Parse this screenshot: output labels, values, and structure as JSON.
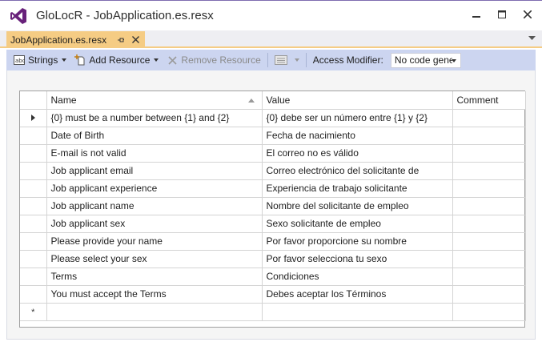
{
  "window": {
    "title": "GloLocR - JobApplication.es.resx",
    "minimize_icon": "minimize-icon",
    "maximize_icon": "maximize-icon",
    "close_icon": "close-icon"
  },
  "tab": {
    "label": "JobApplication.es.resx",
    "pin_icon": "pin-icon",
    "close_icon": "close-icon",
    "accent_color": "#f5cc84"
  },
  "toolbar": {
    "strings_label": "Strings",
    "add_resource_label": "Add Resource",
    "remove_resource_label": "Remove Resource",
    "access_modifier_label": "Access Modifier:",
    "access_modifier_value": "No code generation"
  },
  "grid": {
    "columns": [
      "Name",
      "Value",
      "Comment"
    ],
    "rows": [
      {
        "name": "{0} must be a number between {1} and {2}",
        "value": "{0} debe ser un número entre {1} y {2}",
        "comment": ""
      },
      {
        "name": "Date of Birth",
        "value": "Fecha de nacimiento",
        "comment": ""
      },
      {
        "name": "E-mail is not valid",
        "value": "El correo no es válido",
        "comment": ""
      },
      {
        "name": "Job applicant email",
        "value": "Correo electrónico del solicitante de",
        "comment": ""
      },
      {
        "name": "Job applicant experience",
        "value": "Experiencia de trabajo solicitante",
        "comment": ""
      },
      {
        "name": "Job applicant name",
        "value": "Nombre del solicitante de empleo",
        "comment": ""
      },
      {
        "name": "Job applicant sex",
        "value": "Sexo solicitante de empleo",
        "comment": ""
      },
      {
        "name": "Please provide your name",
        "value": "Por favor proporcione su nombre",
        "comment": ""
      },
      {
        "name": "Please select your sex",
        "value": "Por favor selecciona tu sexo",
        "comment": ""
      },
      {
        "name": "Terms",
        "value": "Condiciones",
        "comment": ""
      },
      {
        "name": "You must accept the Terms",
        "value": "Debes aceptar los Términos",
        "comment": ""
      }
    ],
    "new_row_marker": "*"
  }
}
